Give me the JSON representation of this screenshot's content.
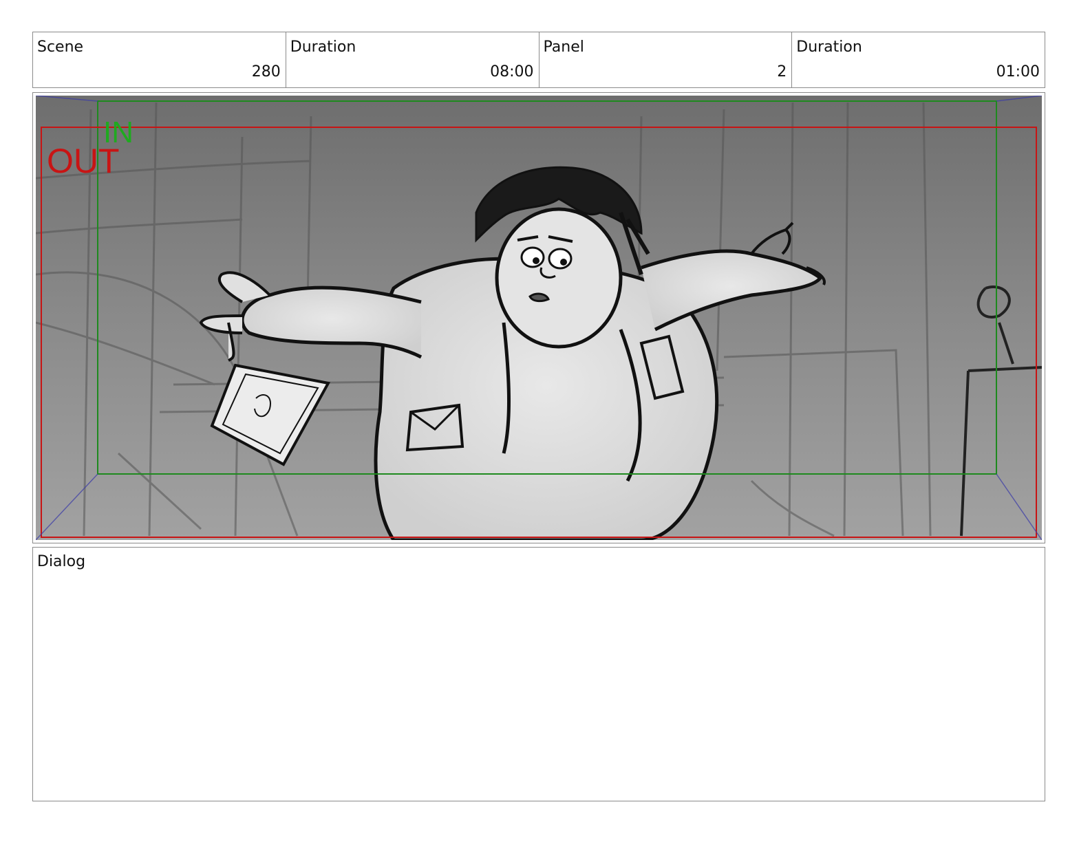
{
  "header": {
    "scene_label": "Scene",
    "scene_value": "280",
    "duration_label": "Duration",
    "duration_value": "08:00",
    "panel_label": "Panel",
    "panel_value": "2",
    "panel_duration_label": "Duration",
    "panel_duration_value": "01:00"
  },
  "panel": {
    "in_label": "IN",
    "out_label": "OUT",
    "in_color": "#1faa1f",
    "out_color": "#c81414"
  },
  "dialog": {
    "label": "Dialog",
    "text": ""
  }
}
